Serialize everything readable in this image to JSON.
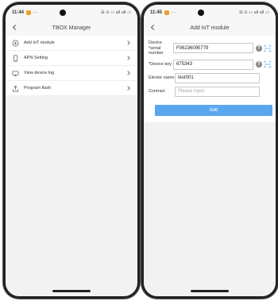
{
  "left": {
    "status": {
      "time": "11:44",
      "dots": "···",
      "sys": "⊟ ⊙ ▭ ull ull ▭"
    },
    "nav": {
      "title": "TBOX Manager"
    },
    "menu": [
      {
        "label": "Add IoT module",
        "icon": "plus-circle-icon"
      },
      {
        "label": "APN Setting",
        "icon": "phone-icon"
      },
      {
        "label": "View device log",
        "icon": "monitor-icon"
      },
      {
        "label": "Program flash",
        "icon": "upload-icon"
      }
    ]
  },
  "right": {
    "status": {
      "time": "11:45",
      "dots": "···",
      "sys": "⊟ ⊙ ▭ ull ull ▭"
    },
    "nav": {
      "title": "Add IoT module"
    },
    "form": {
      "serial": {
        "label": "Device *serial number",
        "value": "F06236095779"
      },
      "key": {
        "label": "*Device key",
        "value": "675343"
      },
      "elevator": {
        "label": "Elevtor name",
        "value": "test001"
      },
      "contract": {
        "label": "Contract",
        "placeholder": "Please input"
      },
      "help_glyph": "?",
      "submit": "Add"
    }
  },
  "colors": {
    "accent": "#5ba7ee",
    "notif": "#f39a2b"
  }
}
